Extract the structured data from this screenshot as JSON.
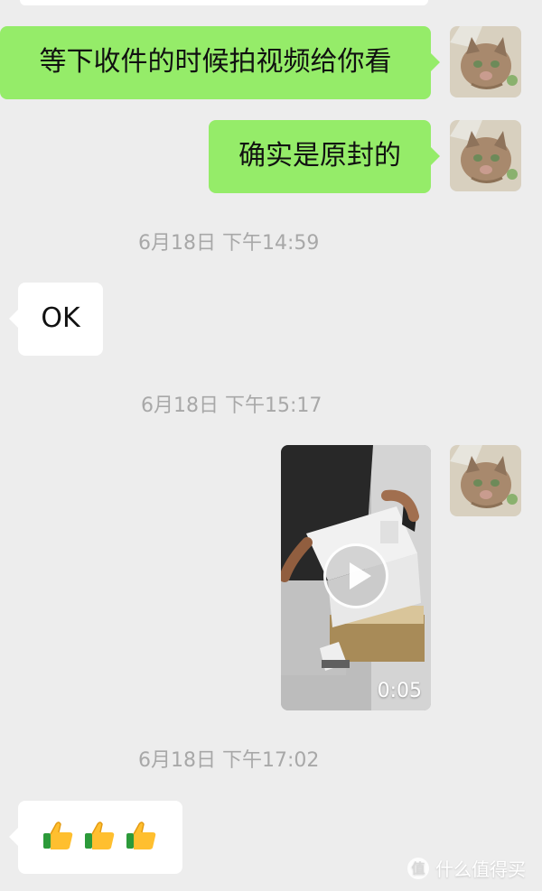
{
  "chat": {
    "messages": [
      {
        "direction": "sent",
        "text": "等下收件的时候拍视频给你看"
      },
      {
        "direction": "sent",
        "text": "确实是原封的"
      },
      {
        "type": "timestamp",
        "text": "6月18日 下午14:59"
      },
      {
        "direction": "received",
        "text": "OK"
      },
      {
        "type": "timestamp",
        "text": "6月18日 下午15:17"
      },
      {
        "direction": "sent",
        "type": "video",
        "duration": "0:05"
      },
      {
        "type": "timestamp",
        "text": "6月18日 下午17:02"
      },
      {
        "direction": "received",
        "type": "emoji",
        "emojis": [
          "thumbs-up",
          "thumbs-up",
          "thumbs-up"
        ]
      }
    ]
  },
  "watermark": {
    "badge": "值",
    "text": "什么值得买"
  },
  "colors": {
    "background": "#ededed",
    "sent_bubble": "#95ec69",
    "received_bubble": "#ffffff",
    "timestamp": "#a8a8a8"
  },
  "icons": [
    "cat-avatar",
    "play-icon",
    "thumbs-up-icon",
    "smzdm-logo-icon"
  ]
}
